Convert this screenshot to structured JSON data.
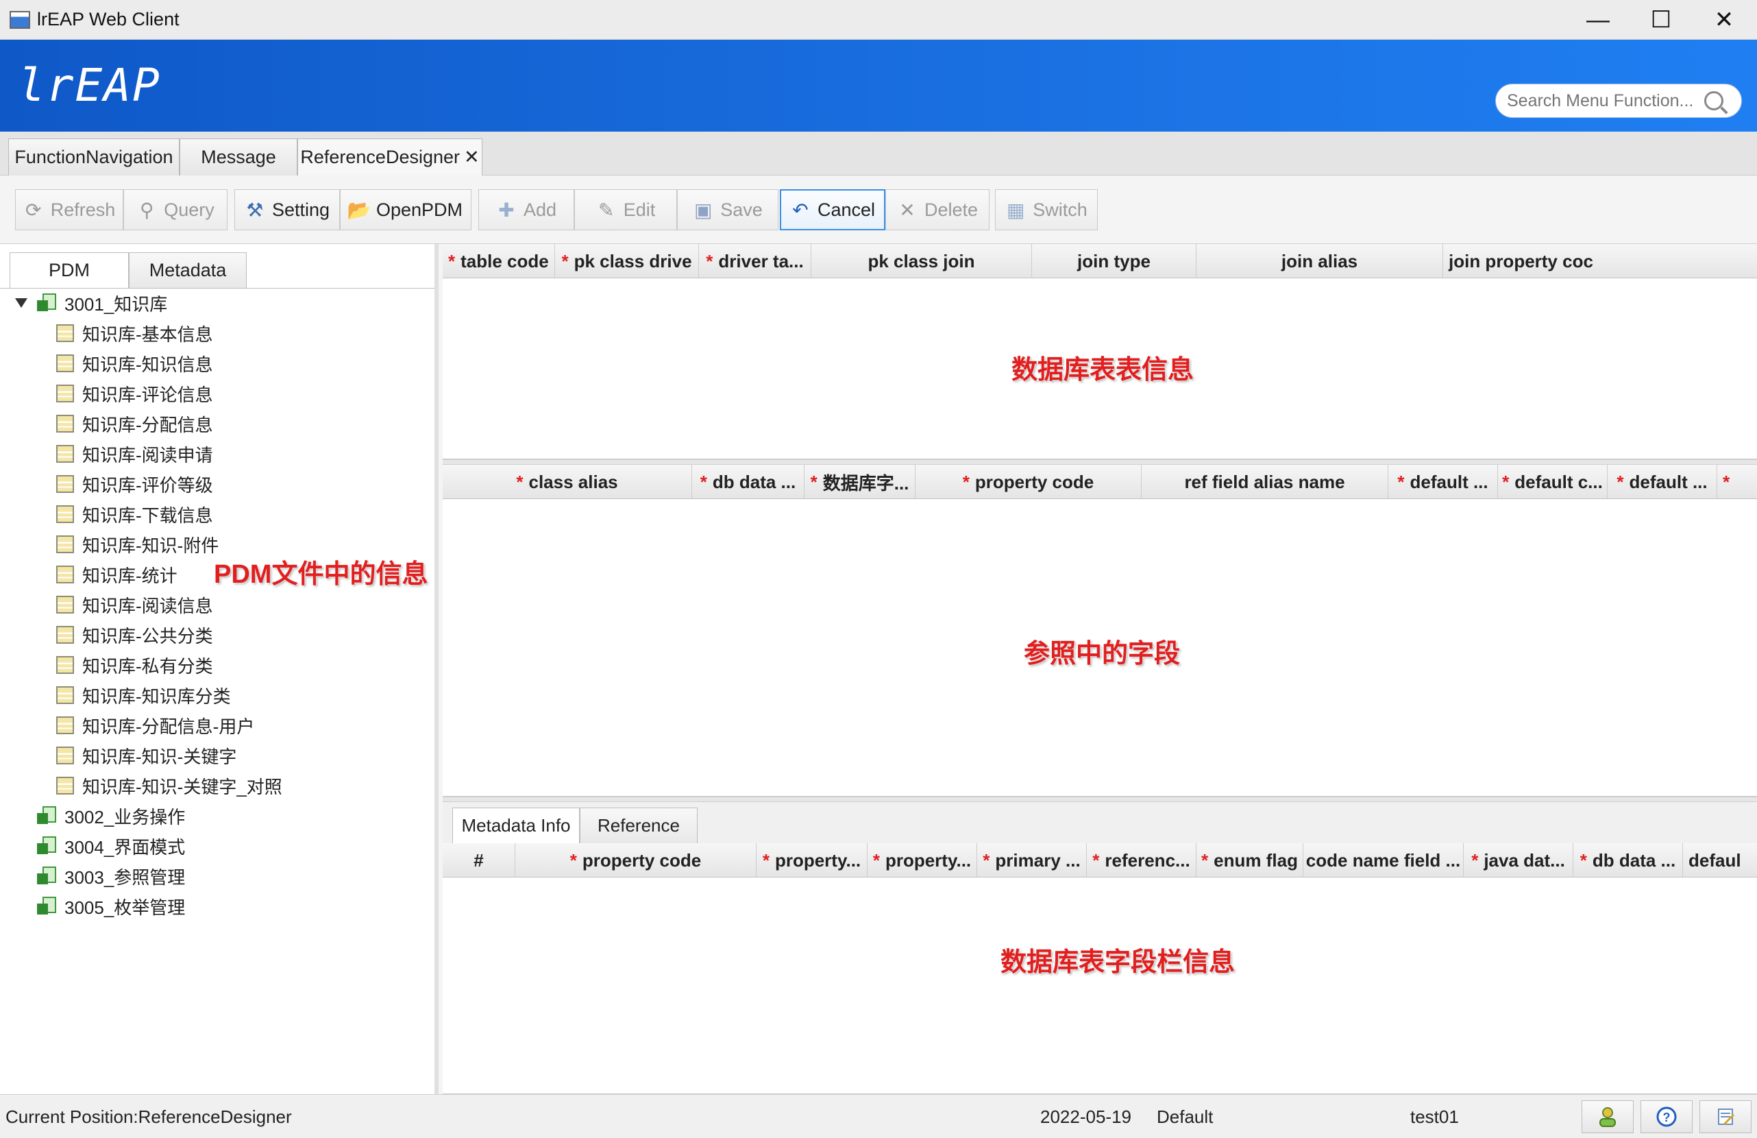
{
  "window": {
    "title": "lrEAP Web Client",
    "minimize": "—",
    "maximize": "☐",
    "close": "✕"
  },
  "header": {
    "logo": "lrEAP",
    "search_placeholder": "Search Menu Function..."
  },
  "tabs": [
    {
      "label": "FunctionNavigation"
    },
    {
      "label": "Message"
    },
    {
      "label": "ReferenceDesigner",
      "close": "✕"
    }
  ],
  "toolbar": {
    "refresh": "Refresh",
    "query": "Query",
    "setting": "Setting",
    "openpdm": "OpenPDM",
    "add": "Add",
    "edit": "Edit",
    "save": "Save",
    "cancel": "Cancel",
    "delete": "Delete",
    "switch": "Switch"
  },
  "left": {
    "tabs": [
      "PDM",
      "Metadata"
    ],
    "tree": [
      {
        "label": "3001_知识库",
        "children": [
          "知识库-基本信息",
          "知识库-知识信息",
          "知识库-评论信息",
          "知识库-分配信息",
          "知识库-阅读申请",
          "知识库-评价等级",
          "知识库-下载信息",
          "知识库-知识-附件",
          "知识库-统计",
          "知识库-阅读信息",
          "知识库-公共分类",
          "知识库-私有分类",
          "知识库-知识库分类",
          "知识库-分配信息-用户",
          "知识库-知识-关键字",
          "知识库-知识-关键字_对照"
        ]
      },
      {
        "label": "3002_业务操作"
      },
      {
        "label": "3004_界面模式"
      },
      {
        "label": "3003_参照管理"
      },
      {
        "label": "3005_枚举管理"
      }
    ],
    "note": "PDM文件中的信息"
  },
  "grid1": {
    "columns": [
      "table code",
      "pk class drive",
      "driver ta...",
      "pk class join",
      "join type",
      "join alias",
      "join property coc"
    ],
    "note": "数据库表表信息"
  },
  "grid2": {
    "columns": [
      "class alias",
      "db data ...",
      "数据库字...",
      "property code",
      "ref field alias name",
      "default ...",
      "default c...",
      "default ...",
      ""
    ],
    "note": "参照中的字段"
  },
  "grid3": {
    "tabs": [
      "Metadata Info",
      "Reference"
    ],
    "columns": [
      "#",
      "property code",
      "property...",
      "property...",
      "primary ...",
      "referenc...",
      "enum flag",
      "code name field ...",
      "java dat...",
      "db data ...",
      "defaul"
    ],
    "note": "数据库表字段栏信息"
  },
  "status": {
    "position": "Current Position:ReferenceDesigner",
    "date": "2022-05-19",
    "mode": "Default",
    "user": "test01"
  }
}
